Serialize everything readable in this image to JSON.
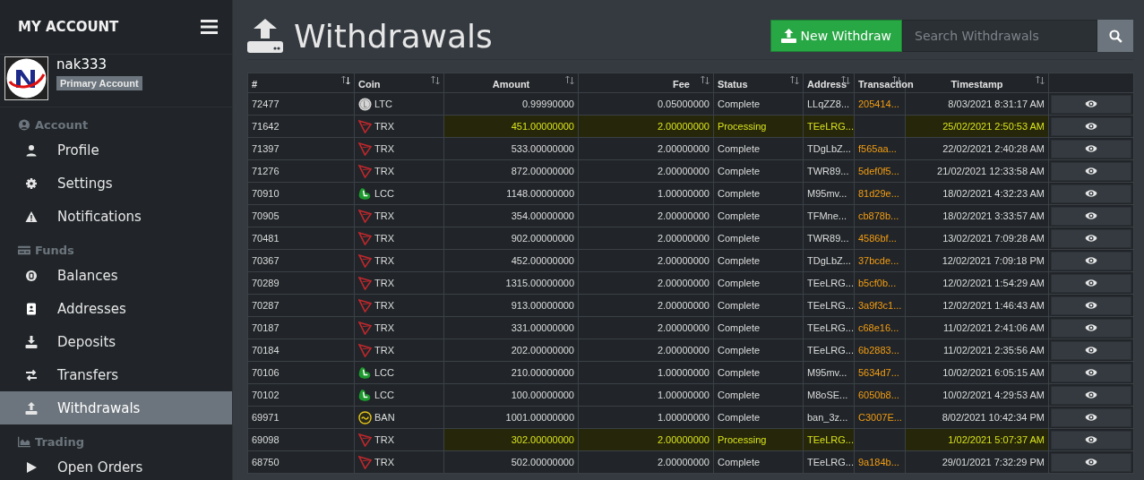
{
  "sidebar": {
    "title": "MY ACCOUNT",
    "user": {
      "name": "nak333",
      "badge": "Primary Account"
    },
    "sections": [
      {
        "label": "Account",
        "items": [
          {
            "label": "Profile",
            "selected": false
          },
          {
            "label": "Settings",
            "selected": false
          },
          {
            "label": "Notifications",
            "selected": false
          }
        ]
      },
      {
        "label": "Funds",
        "items": [
          {
            "label": "Balances",
            "selected": false
          },
          {
            "label": "Addresses",
            "selected": false
          },
          {
            "label": "Deposits",
            "selected": false
          },
          {
            "label": "Transfers",
            "selected": false
          },
          {
            "label": "Withdrawals",
            "selected": true
          }
        ]
      },
      {
        "label": "Trading",
        "items": [
          {
            "label": "Open Orders",
            "selected": false
          }
        ]
      }
    ]
  },
  "header": {
    "title": "Withdrawals",
    "new_button": "New Withdraw",
    "search": {
      "placeholder": "Search Withdrawals"
    }
  },
  "table": {
    "columns": [
      {
        "label": "#",
        "sorted": true
      },
      {
        "label": "Coin",
        "sorted": false
      },
      {
        "label": "Amount",
        "sorted": false
      },
      {
        "label": "Fee",
        "sorted": false
      },
      {
        "label": "Status",
        "sorted": false
      },
      {
        "label": "Address",
        "sorted": false
      },
      {
        "label": "Transaction",
        "sorted": false
      },
      {
        "label": "Timestamp",
        "sorted": false
      }
    ],
    "rows": [
      {
        "id": "72477",
        "coin": "LTC",
        "kind": "ltc",
        "amount": "0.99990000",
        "fee": "0.05000000",
        "status": "Complete",
        "pending": false,
        "address": "LLqZZ8...",
        "transaction": "205414...",
        "timestamp": "8/03/2021 8:31:17 AM"
      },
      {
        "id": "71642",
        "coin": "TRX",
        "kind": "trx",
        "amount": "451.00000000",
        "fee": "2.00000000",
        "status": "Processing",
        "pending": true,
        "address": "TEeLRG...",
        "timestamp": "25/02/2021 2:50:53 AM"
      },
      {
        "id": "71397",
        "coin": "TRX",
        "kind": "trx",
        "amount": "533.00000000",
        "fee": "2.00000000",
        "status": "Complete",
        "pending": false,
        "address": "TDgLbZ...",
        "transaction": "f565aa...",
        "timestamp": "22/02/2021 2:40:28 AM"
      },
      {
        "id": "71276",
        "coin": "TRX",
        "kind": "trx",
        "amount": "872.00000000",
        "fee": "2.00000000",
        "status": "Complete",
        "pending": false,
        "address": "TWR89...",
        "transaction": "5def0f5...",
        "timestamp": "21/02/2021 12:33:58 AM"
      },
      {
        "id": "70910",
        "coin": "LCC",
        "kind": "lcc",
        "amount": "1148.00000000",
        "fee": "1.00000000",
        "status": "Complete",
        "pending": false,
        "address": "M95mv...",
        "transaction": "81d29e...",
        "timestamp": "18/02/2021 4:32:23 AM"
      },
      {
        "id": "70905",
        "coin": "TRX",
        "kind": "trx",
        "amount": "354.00000000",
        "fee": "2.00000000",
        "status": "Complete",
        "pending": false,
        "address": "TFMne...",
        "transaction": "cb878b...",
        "timestamp": "18/02/2021 3:33:57 AM"
      },
      {
        "id": "70481",
        "coin": "TRX",
        "kind": "trx",
        "amount": "902.00000000",
        "fee": "2.00000000",
        "status": "Complete",
        "pending": false,
        "address": "TWR89...",
        "transaction": "4586bf...",
        "timestamp": "13/02/2021 7:09:28 AM"
      },
      {
        "id": "70367",
        "coin": "TRX",
        "kind": "trx",
        "amount": "452.00000000",
        "fee": "2.00000000",
        "status": "Complete",
        "pending": false,
        "address": "TDgLbZ...",
        "transaction": "37bcde...",
        "timestamp": "12/02/2021 7:09:18 PM"
      },
      {
        "id": "70289",
        "coin": "TRX",
        "kind": "trx",
        "amount": "1315.00000000",
        "fee": "2.00000000",
        "status": "Complete",
        "pending": false,
        "address": "TEeLRG...",
        "transaction": "b5cf0b...",
        "timestamp": "12/02/2021 1:54:29 AM"
      },
      {
        "id": "70287",
        "coin": "TRX",
        "kind": "trx",
        "amount": "913.00000000",
        "fee": "2.00000000",
        "status": "Complete",
        "pending": false,
        "address": "TEeLRG...",
        "transaction": "3a9f3c1...",
        "timestamp": "12/02/2021 1:46:43 AM"
      },
      {
        "id": "70187",
        "coin": "TRX",
        "kind": "trx",
        "amount": "331.00000000",
        "fee": "2.00000000",
        "status": "Complete",
        "pending": false,
        "address": "TEeLRG...",
        "transaction": "c68e16...",
        "timestamp": "11/02/2021 2:41:06 AM"
      },
      {
        "id": "70184",
        "coin": "TRX",
        "kind": "trx",
        "amount": "202.00000000",
        "fee": "2.00000000",
        "status": "Complete",
        "pending": false,
        "address": "TEeLRG...",
        "transaction": "6b2883...",
        "timestamp": "11/02/2021 2:35:56 AM"
      },
      {
        "id": "70106",
        "coin": "LCC",
        "kind": "lcc",
        "amount": "210.00000000",
        "fee": "1.00000000",
        "status": "Complete",
        "pending": false,
        "address": "M95mv...",
        "transaction": "5634d7...",
        "timestamp": "10/02/2021 6:05:15 AM"
      },
      {
        "id": "70102",
        "coin": "LCC",
        "kind": "lcc",
        "amount": "100.00000000",
        "fee": "1.00000000",
        "status": "Complete",
        "pending": false,
        "address": "M8oSE...",
        "transaction": "6050b8...",
        "timestamp": "10/02/2021 4:29:53 AM"
      },
      {
        "id": "69971",
        "coin": "BAN",
        "kind": "ban",
        "amount": "1001.00000000",
        "fee": "1.00000000",
        "status": "Complete",
        "pending": false,
        "address": "ban_3z...",
        "transaction": "C3007E...",
        "timestamp": "8/02/2021 10:42:34 PM"
      },
      {
        "id": "69098",
        "coin": "TRX",
        "kind": "trx",
        "amount": "302.00000000",
        "fee": "2.00000000",
        "status": "Processing",
        "pending": true,
        "address": "TEeLRG...",
        "timestamp": "1/02/2021 5:07:37 AM"
      },
      {
        "id": "68750",
        "coin": "TRX",
        "kind": "trx",
        "amount": "502.00000000",
        "fee": "2.00000000",
        "status": "Complete",
        "pending": false,
        "address": "TEeLRG...",
        "transaction": "9a184b...",
        "timestamp": "29/01/2021 7:32:29 PM"
      }
    ]
  }
}
